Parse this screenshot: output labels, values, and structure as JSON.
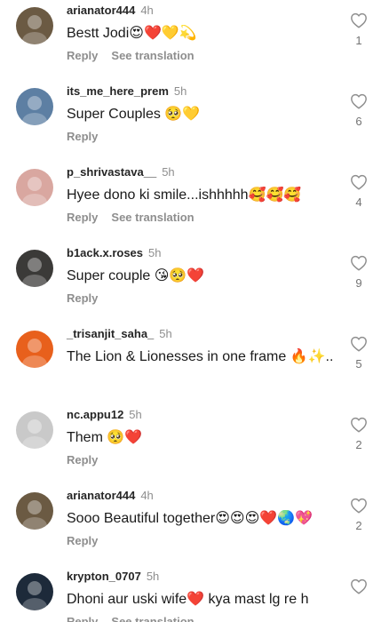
{
  "comments": [
    {
      "username": "arianator444",
      "time": "4h",
      "text": "Bestt Jodi😍❤️💛💫",
      "reply_label": "Reply",
      "translate_label": "See translation",
      "likes": "1",
      "avatar_color": "#6b5a43"
    },
    {
      "username": "its_me_here_prem",
      "time": "5h",
      "text": "Super Couples 🥺💛",
      "reply_label": "Reply",
      "translate_label": "",
      "likes": "6",
      "avatar_color": "#5d7fa3"
    },
    {
      "username": "p_shrivastava__",
      "time": "5h",
      "text": "Hyee dono ki smile...ishhhhh🥰🥰🥰",
      "reply_label": "Reply",
      "translate_label": "See translation",
      "likes": "4",
      "avatar_color": "#d9a7a0"
    },
    {
      "username": "b1ack.x.roses",
      "time": "5h",
      "text": "Super couple 😘🥺❤️",
      "reply_label": "Reply",
      "translate_label": "",
      "likes": "9",
      "avatar_color": "#3b3a38"
    },
    {
      "username": "_trisanjit_saha_",
      "time": "5h",
      "text": "The Lion & Lionesses in one frame 🔥✨...",
      "reply_label": "",
      "translate_label": "",
      "likes": "5",
      "avatar_color": "#e8601c"
    },
    {
      "username": "nc.appu12",
      "time": "5h",
      "text": "Them 🥺❤️",
      "reply_label": "Reply",
      "translate_label": "",
      "likes": "2",
      "avatar_color": "#c9c9c9"
    },
    {
      "username": "arianator444",
      "time": "4h",
      "text": "Sooo Beautiful together😍😍😍❤️🌏💖",
      "reply_label": "Reply",
      "translate_label": "",
      "likes": "2",
      "avatar_color": "#6b5a43"
    },
    {
      "username": "krypton_0707",
      "time": "5h",
      "text": "Dhoni aur uski wife❤️ kya mast lg re h",
      "reply_label": "Reply",
      "translate_label": "See translation",
      "likes": "",
      "avatar_color": "#1d2a3a"
    }
  ]
}
